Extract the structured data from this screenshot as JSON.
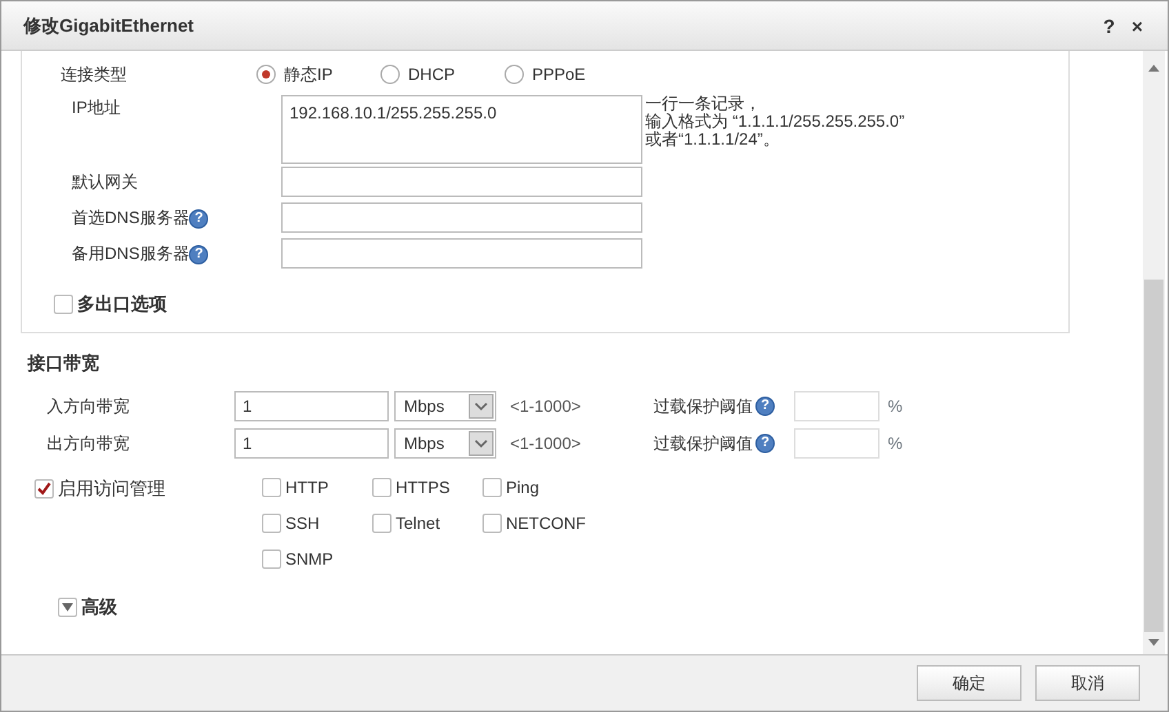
{
  "window": {
    "title": "修改GigabitEthernet",
    "help": "?",
    "close": "×"
  },
  "connection": {
    "label": "连接类型",
    "options": [
      {
        "label": "静态IP",
        "selected": true
      },
      {
        "label": "DHCP",
        "selected": false
      },
      {
        "label": "PPPoE",
        "selected": false
      }
    ]
  },
  "ip": {
    "label": "IP地址",
    "value": "192.168.10.1/255.255.255.0",
    "hint": [
      "一行一条记录，",
      "输入格式为 “1.1.1.1/255.255.255.0”",
      "或者“1.1.1.1/24”。"
    ]
  },
  "fields": [
    {
      "label": "默认网关"
    },
    {
      "label": "首选DNS服务器",
      "help": "?"
    },
    {
      "label": "备用DNS服务器",
      "help": "?"
    }
  ],
  "multi_exit": {
    "label": "多出口选项",
    "checked": false
  },
  "bandwidth": {
    "title": "接口带宽",
    "rows": [
      {
        "label": "入方向带宽",
        "value": "1",
        "unit": "Mbps",
        "range": "<1-1000>",
        "threshold_label": "过载保护阈值",
        "help": "?",
        "percent": "%"
      },
      {
        "label": "出方向带宽",
        "value": "1",
        "unit": "Mbps",
        "range": "<1-1000>",
        "threshold_label": "过载保护阈值",
        "help": "?",
        "percent": "%"
      }
    ]
  },
  "access": {
    "label": "启用访问管理",
    "checked": true,
    "protocols": [
      {
        "label": "HTTP",
        "checked": false
      },
      {
        "label": "HTTPS",
        "checked": false
      },
      {
        "label": "Ping",
        "checked": false
      },
      {
        "label": "SSH",
        "checked": false
      },
      {
        "label": "Telnet",
        "checked": false
      },
      {
        "label": "NETCONF",
        "checked": false
      },
      {
        "label": "SNMP",
        "checked": false
      }
    ]
  },
  "advanced": {
    "label": "高级",
    "expanded": false
  },
  "buttons": [
    {
      "label": "确定"
    },
    {
      "label": "取消"
    }
  ]
}
